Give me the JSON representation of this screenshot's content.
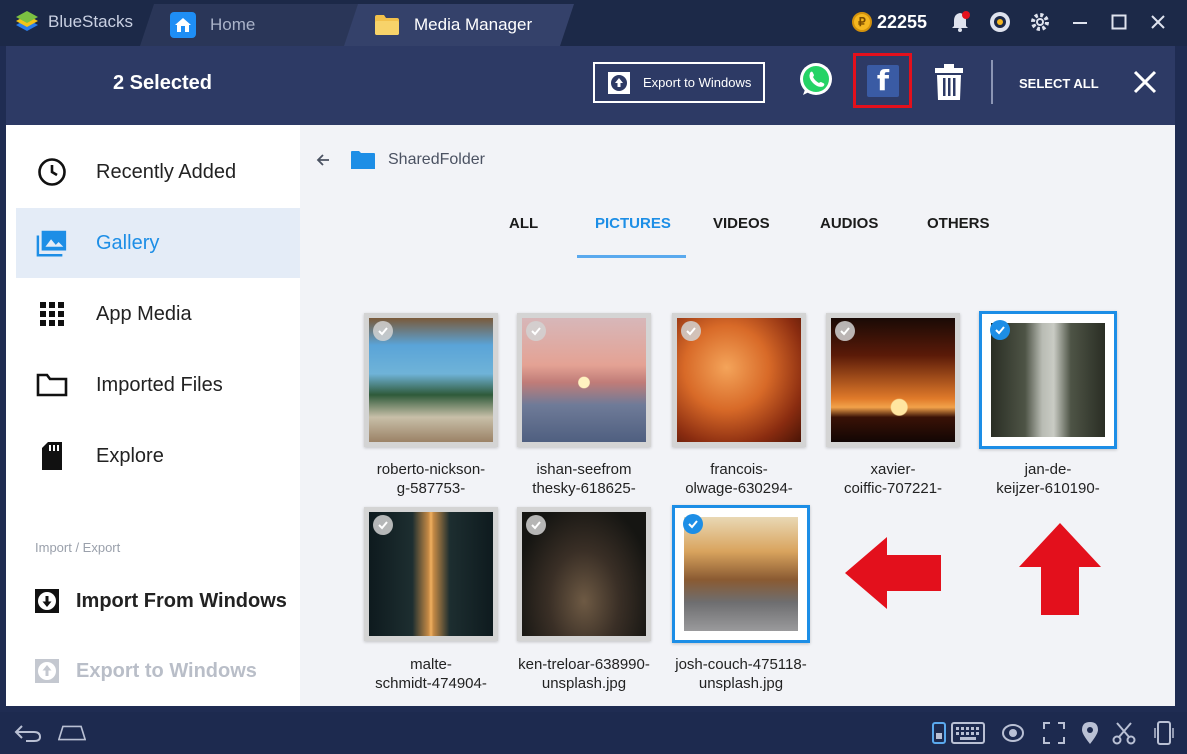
{
  "app": {
    "name": "BlueStacks"
  },
  "tabs": {
    "home": "Home",
    "media": "Media Manager"
  },
  "coins": "22255",
  "actionbar": {
    "selected": "2 Selected",
    "export_label": "Export to Windows",
    "select_all": "SELECT ALL"
  },
  "sidebar": {
    "items": [
      {
        "label": "Recently Added",
        "icon": "clock-icon"
      },
      {
        "label": "Gallery",
        "icon": "gallery-icon"
      },
      {
        "label": "App Media",
        "icon": "grid-icon"
      },
      {
        "label": "Imported Files",
        "icon": "folder-icon"
      },
      {
        "label": "Explore",
        "icon": "sdcard-icon"
      }
    ],
    "section": "Import / Export",
    "import": "Import From Windows",
    "export": "Export to Windows"
  },
  "breadcrumb": {
    "folder": "SharedFolder"
  },
  "filter_tabs": [
    "ALL",
    "PICTURES",
    "VIDEOS",
    "AUDIOS",
    "OTHERS"
  ],
  "active_filter": "PICTURES",
  "files": [
    {
      "line1": "roberto-nickson-",
      "line2": "g-587753-",
      "selected": false
    },
    {
      "line1": "ishan-seefrom",
      "line2": "thesky-618625-",
      "selected": false
    },
    {
      "line1": "francois-",
      "line2": "olwage-630294-",
      "selected": false
    },
    {
      "line1": "xavier-",
      "line2": "coiffic-707221-",
      "selected": false
    },
    {
      "line1": "jan-de-",
      "line2": "keijzer-610190-",
      "selected": true
    },
    {
      "line1": "malte-",
      "line2": "schmidt-474904-",
      "selected": false
    },
    {
      "line1": "ken-treloar-638990-",
      "line2": "unsplash.jpg",
      "selected": false
    },
    {
      "line1": "josh-couch-475118-",
      "line2": "unsplash.jpg",
      "selected": true
    }
  ],
  "colors": {
    "accent": "#1d8ee6",
    "highlight": "#e3101c",
    "header": "#2d3a65"
  }
}
